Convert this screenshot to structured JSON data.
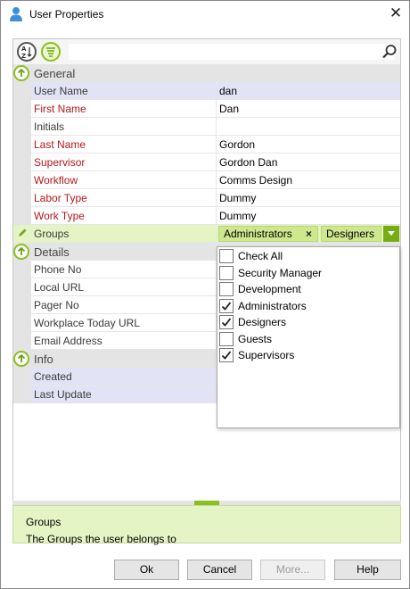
{
  "window": {
    "title": "User Properties",
    "icon": "user-icon",
    "close_label": "✕"
  },
  "toolbar": {
    "sort_icon": "sort-az-icon",
    "category_icon": "categorize-icon",
    "search_placeholder": "",
    "search_icon": "search-icon"
  },
  "categories": [
    {
      "name": "General",
      "properties": [
        {
          "name": "User Name",
          "value": "dan",
          "required": false
        },
        {
          "name": "First Name",
          "value": "Dan",
          "required": true
        },
        {
          "name": "Initials",
          "value": "",
          "required": false
        },
        {
          "name": "Last Name",
          "value": "Gordon",
          "required": true
        },
        {
          "name": "Supervisor",
          "value": "Gordon Dan",
          "required": true
        },
        {
          "name": "Workflow",
          "value": "Comms Design",
          "required": true
        },
        {
          "name": "Labor Type",
          "value": "Dummy",
          "required": true
        },
        {
          "name": "Work Type",
          "value": "Dummy",
          "required": true
        },
        {
          "name": "Groups",
          "value": "",
          "required": false
        }
      ]
    },
    {
      "name": "Details",
      "properties": [
        {
          "name": "Phone No",
          "value": "",
          "required": false
        },
        {
          "name": "Local URL",
          "value": "",
          "required": false
        },
        {
          "name": "Pager No",
          "value": "",
          "required": false
        },
        {
          "name": "Workplace Today URL",
          "value": "",
          "required": false
        },
        {
          "name": "Email Address",
          "value": "",
          "required": false
        }
      ]
    },
    {
      "name": "Info",
      "properties": [
        {
          "name": "Created",
          "value": "",
          "required": false
        },
        {
          "name": "Last Update",
          "value": "",
          "required": false
        }
      ]
    }
  ],
  "groups_editor": {
    "tags": [
      "Administrators",
      "Designers"
    ],
    "remove_label": "×",
    "options": [
      {
        "label": "Check All",
        "checked": false
      },
      {
        "label": "Security Manager",
        "checked": false
      },
      {
        "label": "Development",
        "checked": false
      },
      {
        "label": "Administrators",
        "checked": true
      },
      {
        "label": "Designers",
        "checked": true
      },
      {
        "label": "Guests",
        "checked": false
      },
      {
        "label": "Supervisors",
        "checked": true
      }
    ]
  },
  "description": {
    "title": "Groups",
    "text": "The Groups the user belongs to"
  },
  "buttons": {
    "ok": "Ok",
    "cancel": "Cancel",
    "more": "More...",
    "help": "Help"
  },
  "colors": {
    "accent": "#8bbf1e",
    "required_text": "#b5171a",
    "selected_row": "#e3e3f6",
    "active_row": "#e5f4c4"
  }
}
